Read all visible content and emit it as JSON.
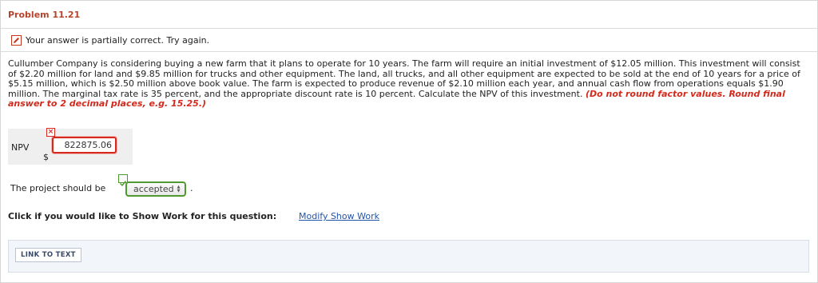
{
  "problem": {
    "title": "Problem 11.21"
  },
  "status": {
    "message": "Your answer is partially correct.  Try again."
  },
  "question": {
    "text": "Cullumber Company is considering buying a new farm that it plans to operate for 10 years. The farm will require an initial investment of $12.05 million. This investment will consist of $2.20 million for land and $9.85 million for trucks and other equipment. The land, all trucks, and all other equipment are expected to be sold at the end of 10 years for a price of $5.15 million, which is $2.50 million above book value. The farm is expected to produce revenue of $2.10 million each year, and annual cash flow from operations equals $1.90 million. The marginal tax rate is 35 percent, and the appropriate discount rate is 10 percent. Calculate the NPV of this investment.",
    "note": "(Do not round factor values. Round final answer to 2 decimal places, e.g. 15.25.)"
  },
  "npv": {
    "label": "NPV",
    "currency": "$",
    "value": "822875.06",
    "state": "incorrect"
  },
  "decision": {
    "prefix": "The project should be",
    "selected": "accepted",
    "suffix": ".",
    "state": "correct"
  },
  "show_work": {
    "label": "Click if you would like to Show Work for this question:",
    "link": "Modify Show Work"
  },
  "footer": {
    "link_button": "LINK TO TEXT"
  },
  "colors": {
    "title": "#b5442a",
    "error": "#d42a20",
    "success": "#4e9a31",
    "link": "#2255aa"
  },
  "icons": {
    "status": "pencil-icon",
    "incorrect": "x-mark-icon",
    "correct": "check-icon"
  }
}
